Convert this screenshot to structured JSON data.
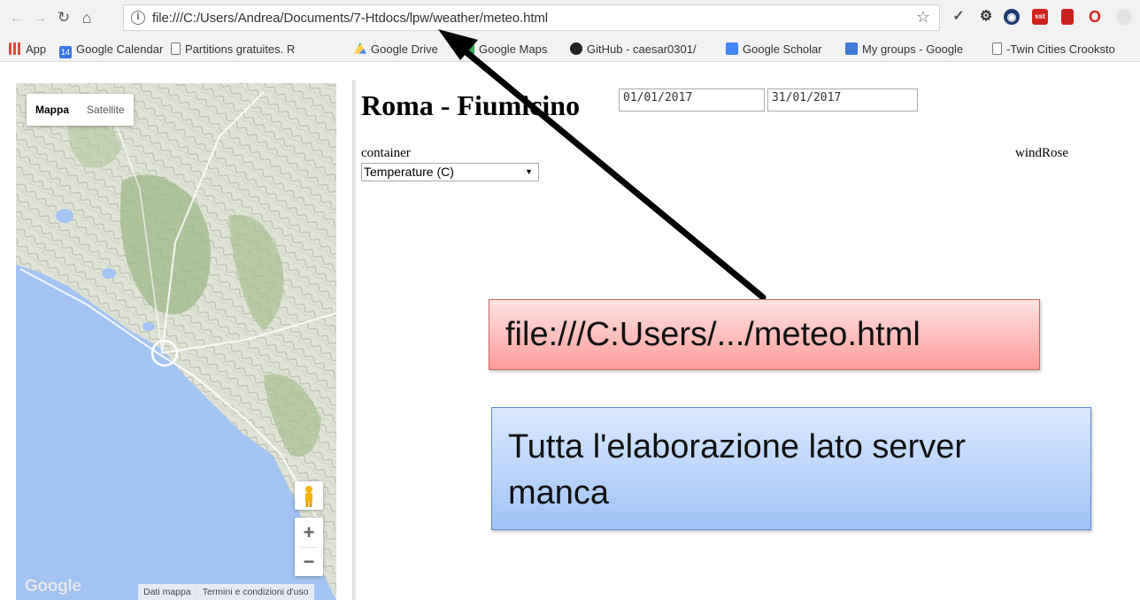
{
  "browser": {
    "url": "file:///C:/Users/Andrea/Documents/7-Htdocs/lpw/weather/meteo.html",
    "bookmarks": [
      {
        "label": "App",
        "icon": "apps-grid-icon",
        "color": "#e04a3a"
      },
      {
        "label": "Google Calendar",
        "icon": "calendar-icon",
        "color": "#3b78e7"
      },
      {
        "label": "Partitions gratuites. R",
        "icon": "page-icon",
        "color": "#ffffff"
      },
      {
        "label": "Google Drive",
        "icon": "drive-icon",
        "color": "#1fa463"
      },
      {
        "label": "Google Maps",
        "icon": "maps-icon",
        "color": "#34a853"
      },
      {
        "label": "GitHub - caesar0301/",
        "icon": "github-icon",
        "color": "#222222"
      },
      {
        "label": "Google Scholar",
        "icon": "scholar-icon",
        "color": "#4285f4"
      },
      {
        "label": "My groups - Google",
        "icon": "groups-icon",
        "color": "#3f7ad6"
      },
      {
        "label": "-Twin Cities Crooksto",
        "icon": "page-icon",
        "color": "#ffffff"
      }
    ],
    "calendar_day": "14"
  },
  "map": {
    "type_buttons": [
      "Mappa",
      "Satellite"
    ],
    "logo": "Google",
    "footer": [
      "Dati mappa",
      "Termini e condizioni d'uso"
    ],
    "zoom_in": "+",
    "zoom_out": "−"
  },
  "page": {
    "title": "Roma - Fiumicino",
    "date_from": "01/01/2017",
    "date_to": "31/01/2017",
    "container_label": "container",
    "metric_selected": "Temperature (C)",
    "windrose_label": "windRose"
  },
  "annotations": {
    "url_callout": "file:///C:Users/.../meteo.html",
    "server_callout": "Tutta l'elaborazione lato server manca"
  }
}
